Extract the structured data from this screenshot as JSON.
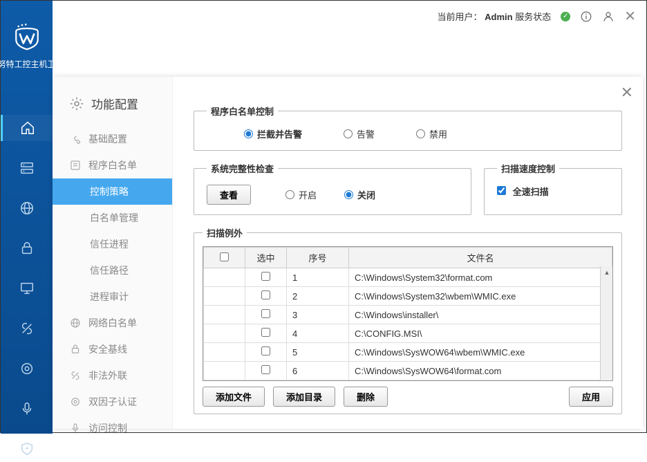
{
  "app_title": "威努特工控主机卫士",
  "header": {
    "prefix": "当前用户：",
    "user": "Admin",
    "status_label": "服务状态"
  },
  "dialog": {
    "title": "功能配置",
    "menu": {
      "basic": "基础配置",
      "whitelist": "程序白名单",
      "strategy": "控制策略",
      "wlmgmt": "白名单管理",
      "trustproc": "信任进程",
      "trustpath": "信任路径",
      "procaudit": "进程审计",
      "netwl": "网络白名单",
      "secbase": "安全基线",
      "illout": "非法外联",
      "twofa": "双因子认证",
      "access": "访问控制"
    }
  },
  "panel1": {
    "legend": "程序白名单控制",
    "opt1": "拦截并告警",
    "opt2": "告警",
    "opt3": "禁用"
  },
  "panel2": {
    "legend": "系统完整性检查",
    "view": "查看",
    "opt_on": "开启",
    "opt_off": "关闭"
  },
  "panel3": {
    "legend": "扫描速度控制",
    "full": "全速扫描"
  },
  "panel4": {
    "legend": "扫描例外",
    "col_sel": "选中",
    "col_idx": "序号",
    "col_file": "文件名",
    "rows": [
      {
        "idx": "1",
        "file": "C:\\Windows\\System32\\format.com"
      },
      {
        "idx": "2",
        "file": "C:\\Windows\\System32\\wbem\\WMIC.exe"
      },
      {
        "idx": "3",
        "file": "C:\\Windows\\installer\\"
      },
      {
        "idx": "4",
        "file": "C:\\CONFIG.MSI\\"
      },
      {
        "idx": "5",
        "file": "C:\\Windows\\SysWOW64\\wbem\\WMIC.exe"
      },
      {
        "idx": "6",
        "file": "C:\\Windows\\SysWOW64\\format.com"
      }
    ],
    "btn_addfile": "添加文件",
    "btn_adddir": "添加目录",
    "btn_del": "删除",
    "btn_apply": "应用"
  }
}
